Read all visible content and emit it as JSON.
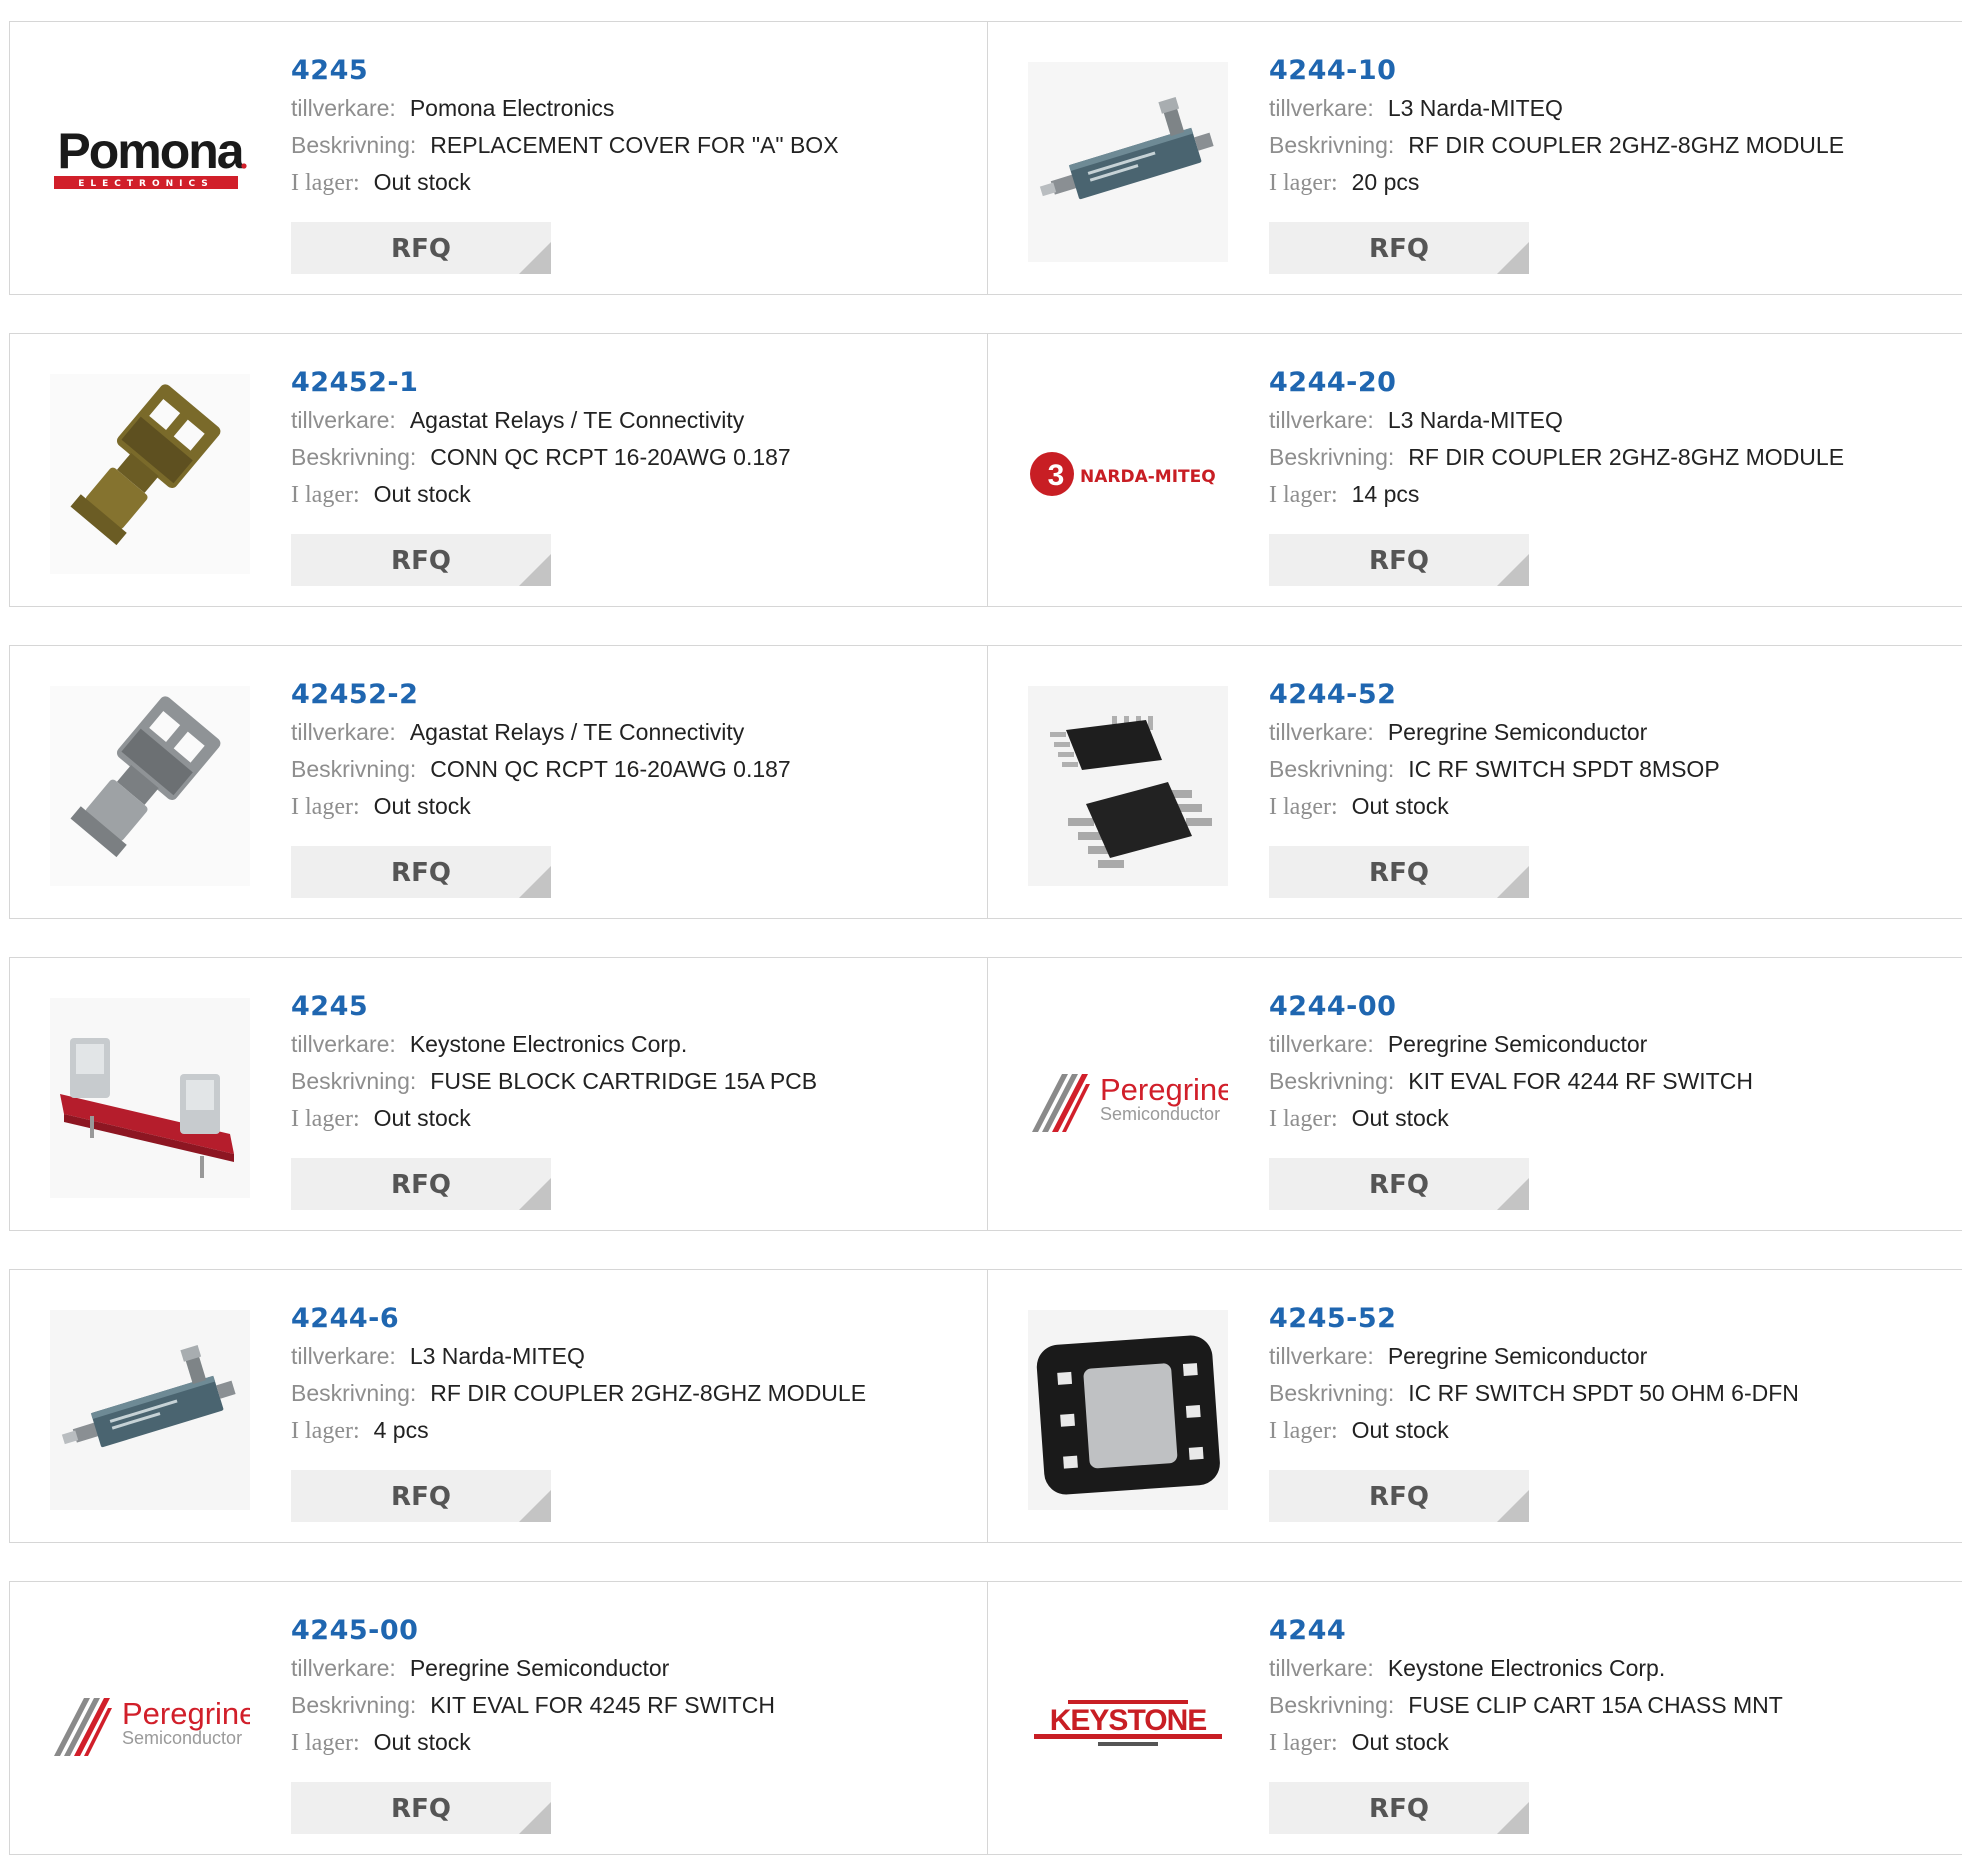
{
  "labels": {
    "manufacturer": "tillverkare:",
    "description": "Beskrivning:",
    "stock": "I lager:",
    "rfq": "RFQ"
  },
  "products": [
    {
      "part": "4245",
      "manufacturer": "Pomona Electronics",
      "description": "REPLACEMENT COVER FOR \"A\" BOX",
      "stock": "Out stock",
      "image": "pomona-logo",
      "logo_text": "Pomona",
      "logo_sub": "ELECTRONICS"
    },
    {
      "part": "4244-10",
      "manufacturer": "L3 Narda-MITEQ",
      "description": "RF DIR COUPLER 2GHZ-8GHZ MODULE",
      "stock": "20 pcs",
      "image": "rf-coupler-photo"
    },
    {
      "part": "42452-1",
      "manufacturer": "Agastat Relays / TE Connectivity",
      "description": "CONN QC RCPT 16-20AWG 0.187",
      "stock": "Out stock",
      "image": "brass-terminal-photo"
    },
    {
      "part": "4244-20",
      "manufacturer": "L3 Narda-MITEQ",
      "description": "RF DIR COUPLER 2GHZ-8GHZ MODULE",
      "stock": "14 pcs",
      "image": "l3-narda-logo",
      "logo_text": "NARDA-MITEQ",
      "logo_mark": "3"
    },
    {
      "part": "42452-2",
      "manufacturer": "Agastat Relays / TE Connectivity",
      "description": "CONN QC RCPT 16-20AWG 0.187",
      "stock": "Out stock",
      "image": "silver-terminal-photo"
    },
    {
      "part": "4244-52",
      "manufacturer": "Peregrine Semiconductor",
      "description": "IC RF SWITCH SPDT 8MSOP",
      "stock": "Out stock",
      "image": "msop-chip-photo"
    },
    {
      "part": "4245",
      "manufacturer": "Keystone Electronics Corp.",
      "description": "FUSE BLOCK CARTRIDGE 15A PCB",
      "stock": "Out stock",
      "image": "fuse-block-photo"
    },
    {
      "part": "4244-00",
      "manufacturer": "Peregrine Semiconductor",
      "description": "KIT EVAL FOR 4244 RF SWITCH",
      "stock": "Out stock",
      "image": "peregrine-logo",
      "logo_text": "Peregrine",
      "logo_sub": "Semiconductor"
    },
    {
      "part": "4244-6",
      "manufacturer": "L3 Narda-MITEQ",
      "description": "RF DIR COUPLER 2GHZ-8GHZ MODULE",
      "stock": "4 pcs",
      "image": "rf-coupler-photo"
    },
    {
      "part": "4245-52",
      "manufacturer": "Peregrine Semiconductor",
      "description": "IC RF SWITCH SPDT 50 OHM 6-DFN",
      "stock": "Out stock",
      "image": "dfn-chip-photo"
    },
    {
      "part": "4245-00",
      "manufacturer": "Peregrine Semiconductor",
      "description": "KIT EVAL FOR 4245 RF SWITCH",
      "stock": "Out stock",
      "image": "peregrine-logo",
      "logo_text": "Peregrine",
      "logo_sub": "Semiconductor"
    },
    {
      "part": "4244",
      "manufacturer": "Keystone Electronics Corp.",
      "description": "FUSE CLIP CART 15A CHASS MNT",
      "stock": "Out stock",
      "image": "keystone-logo",
      "logo_text": "KEYSTONE"
    }
  ],
  "colors": {
    "part_link": "#1f66b0",
    "label": "#8e8e8e",
    "value": "#222222",
    "rfq_bg": "#efefef",
    "rfq_corner": "#c4c4c4",
    "border": "#d6d6d6"
  }
}
